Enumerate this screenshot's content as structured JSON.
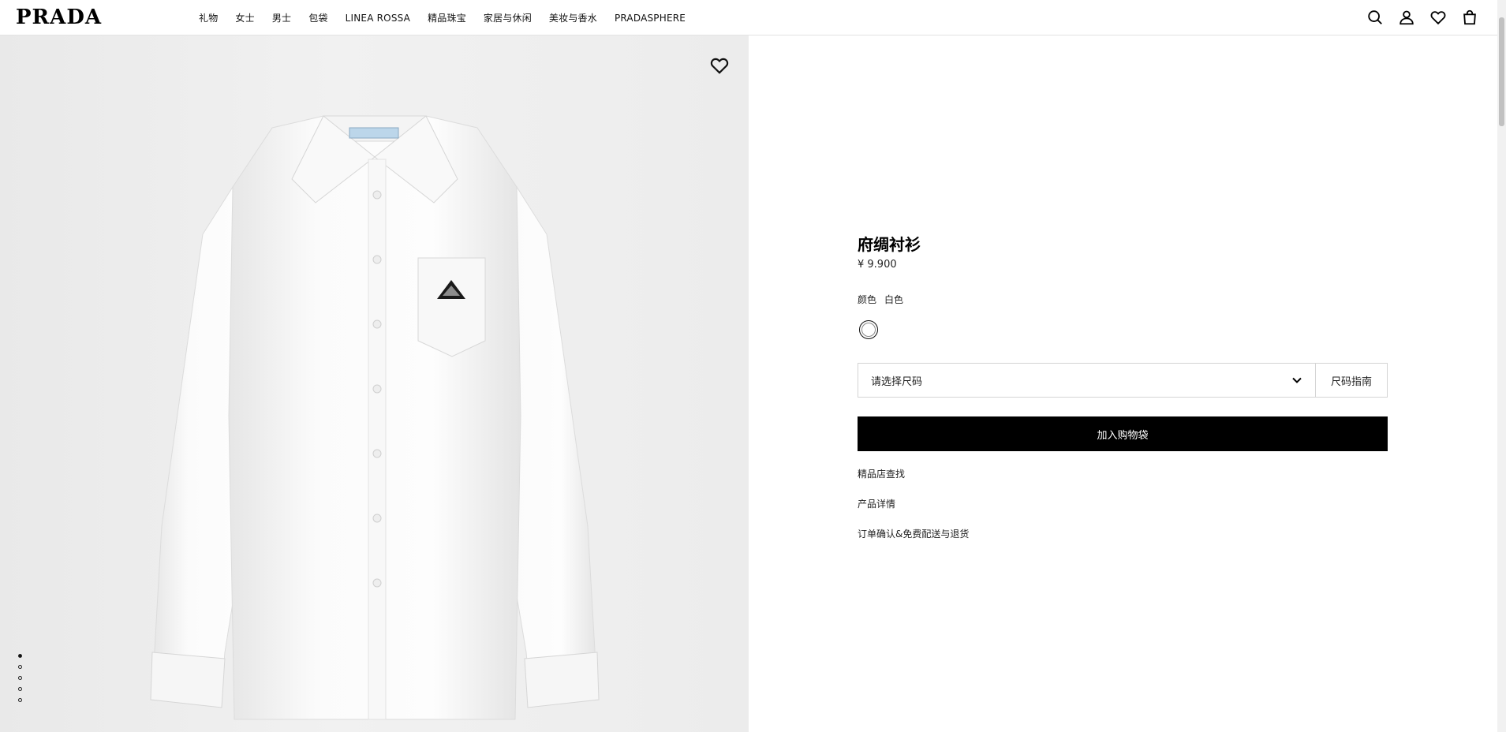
{
  "header": {
    "logo": "PRADA",
    "nav": [
      "礼物",
      "女士",
      "男士",
      "包袋",
      "LINEA ROSSA",
      "精品珠宝",
      "家居与休闲",
      "美妆与香水",
      "PRADASPHERE"
    ],
    "icons": [
      "search-icon",
      "account-icon",
      "wishlist-icon",
      "shopping-bag-icon"
    ]
  },
  "gallery": {
    "image": "white-poplin-shirt",
    "image_count": 5,
    "active_index": 0
  },
  "product": {
    "title": "府绸衬衫",
    "price": "¥ 9.900",
    "color_label": "颜色",
    "color_value": "白色",
    "swatch_color": "#ffffff",
    "size_placeholder": "请选择尺码",
    "size_guide": "尺码指南",
    "add_to_bag": "加入购物袋",
    "links": [
      "精品店查找",
      "产品详情",
      "订单确认&免费配送与退货"
    ]
  },
  "colors": {
    "accent": "#000000",
    "image_bg": "#ececec",
    "border": "#d4d4d4"
  }
}
